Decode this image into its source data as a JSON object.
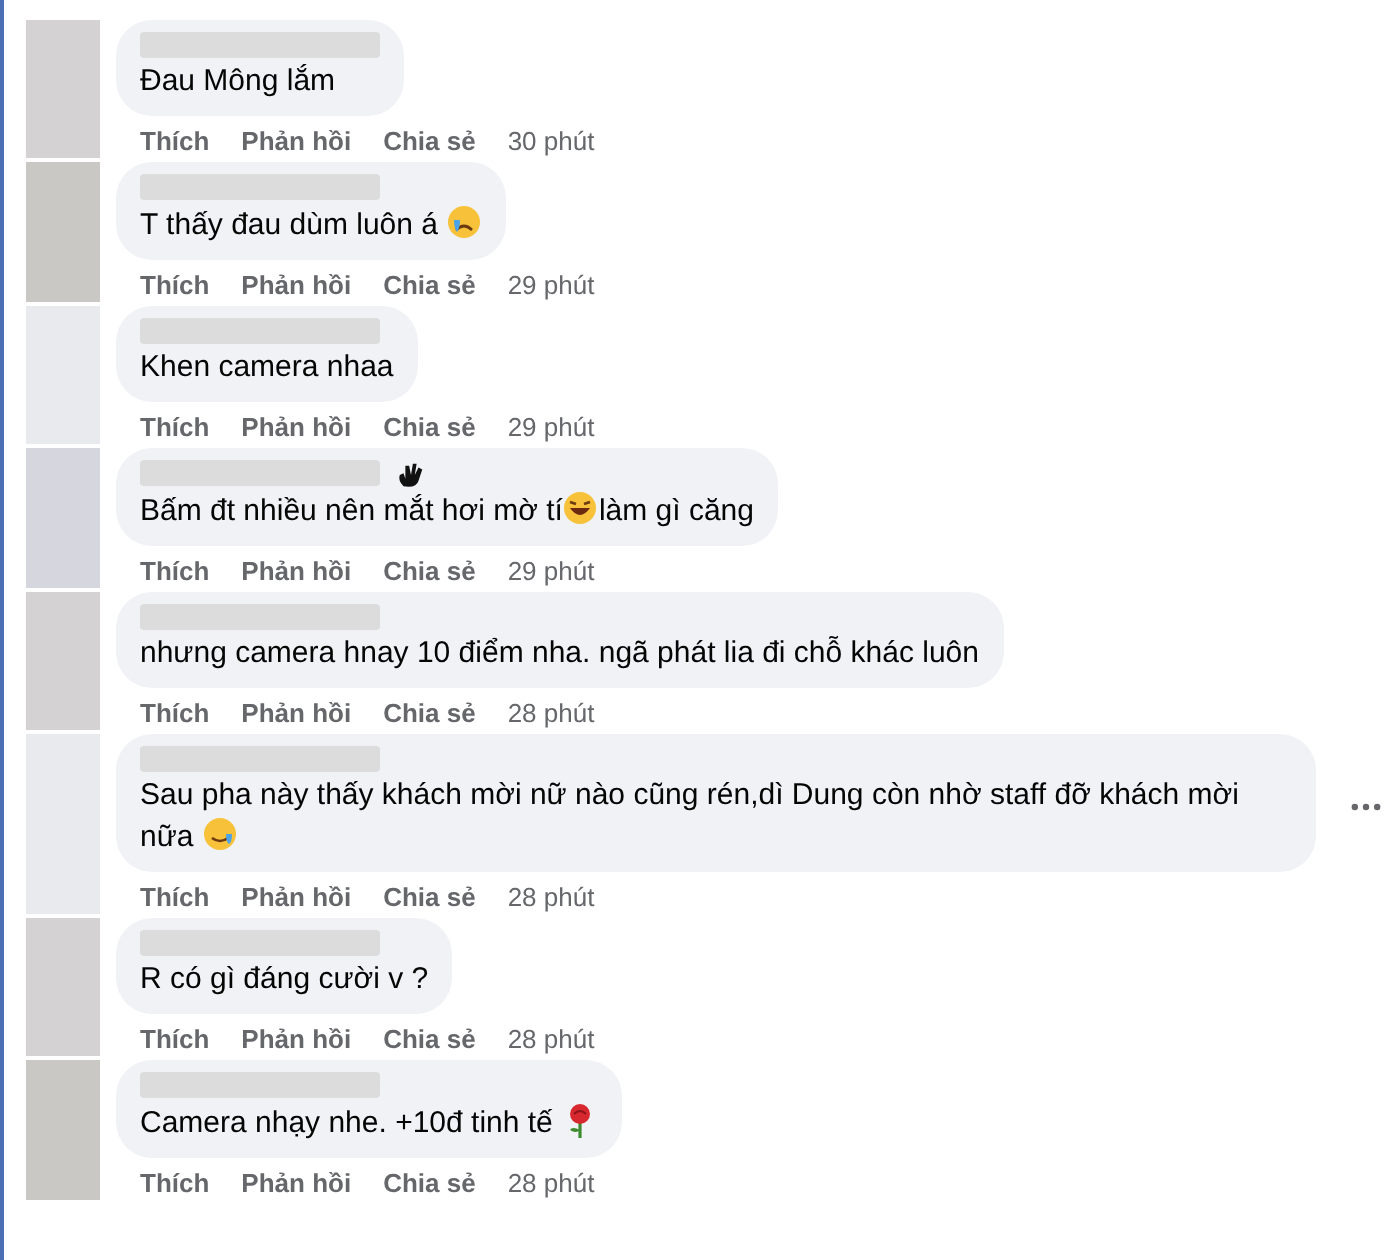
{
  "comments": [
    {
      "parts": [
        {
          "kind": "text",
          "text": "Đau Mông lắm"
        }
      ],
      "name_icon": false,
      "menu": false,
      "actions": [
        "Thích",
        "Phản hồi",
        "Chia sẻ"
      ],
      "time": "30 phút"
    },
    {
      "parts": [
        {
          "kind": "text",
          "text": "T thấy đau dùm luôn á "
        },
        {
          "kind": "sad-face"
        }
      ],
      "name_icon": false,
      "menu": false,
      "actions": [
        "Thích",
        "Phản hồi",
        "Chia sẻ"
      ],
      "time": "29 phút"
    },
    {
      "parts": [
        {
          "kind": "text",
          "text": "Khen camera nhaa"
        }
      ],
      "name_icon": false,
      "menu": false,
      "actions": [
        "Thích",
        "Phản hồi",
        "Chia sẻ"
      ],
      "time": "29 phút"
    },
    {
      "parts": [
        {
          "kind": "text",
          "text": "Bấm đt nhiều nên mắt hơi mờ tí"
        },
        {
          "kind": "laugh-face"
        },
        {
          "kind": "text",
          "text": "làm gì căng"
        }
      ],
      "name_icon": true,
      "menu": false,
      "actions": [
        "Thích",
        "Phản hồi",
        "Chia sẻ"
      ],
      "time": "29 phút"
    },
    {
      "parts": [
        {
          "kind": "text",
          "text": "nhưng camera hnay 10 điểm nha. ngã phát lia đi chỗ khác luôn"
        }
      ],
      "name_icon": false,
      "menu": false,
      "actions": [
        "Thích",
        "Phản hồi",
        "Chia sẻ"
      ],
      "time": "28 phút"
    },
    {
      "parts": [
        {
          "kind": "text",
          "text": "Sau pha này thấy khách mời nữ nào cũng rén,dì Dung còn nhờ staff đỡ khách mời nữa "
        },
        {
          "kind": "tear-smile"
        }
      ],
      "name_icon": false,
      "menu": true,
      "actions": [
        "Thích",
        "Phản hồi",
        "Chia sẻ"
      ],
      "time": "28 phút"
    },
    {
      "parts": [
        {
          "kind": "text",
          "text": "R có gì đáng cười v ?"
        }
      ],
      "name_icon": false,
      "menu": false,
      "actions": [
        "Thích",
        "Phản hồi",
        "Chia sẻ"
      ],
      "time": "28 phút"
    },
    {
      "parts": [
        {
          "kind": "text",
          "text": "Camera nhạy nhe. +10đ tinh tế "
        },
        {
          "kind": "rose"
        }
      ],
      "name_icon": false,
      "menu": false,
      "actions": [
        "Thích",
        "Phản hồi",
        "Chia sẻ"
      ],
      "time": "28 phút"
    }
  ]
}
